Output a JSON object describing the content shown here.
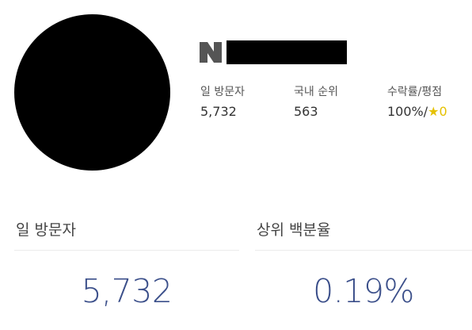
{
  "profile": {
    "avatar": "redacted-profile-image",
    "platform_icon": "naver-n-icon",
    "name": ""
  },
  "stats": [
    {
      "label": "일 방문자",
      "value": "5,732"
    },
    {
      "label": "국내 순위",
      "value": "563"
    },
    {
      "label": "수락률/평점",
      "value": "100%/",
      "star": "★",
      "rating": "0"
    }
  ],
  "panels": {
    "daily_visitors": {
      "title": "일 방문자",
      "value": "5,732"
    },
    "top_percentile": {
      "title": "상위 백분율",
      "value": "0.19%"
    }
  },
  "colors": {
    "accent": "#3b4f8a",
    "star": "#e5c100",
    "divider": "#ececec"
  }
}
